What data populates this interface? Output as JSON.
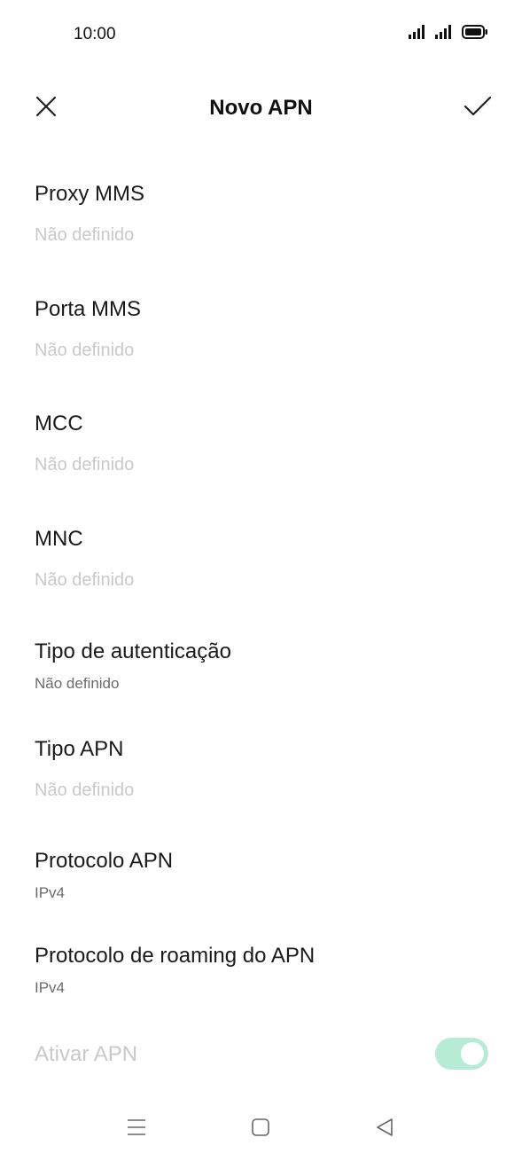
{
  "status_bar": {
    "time": "10:00",
    "icons": [
      "signal-icon",
      "signal-icon",
      "battery-icon"
    ]
  },
  "header": {
    "title": "Novo APN",
    "close_icon": "close-icon",
    "confirm_icon": "check-icon"
  },
  "fields": [
    {
      "label": "Proxy MMS",
      "value": "Não definido",
      "state": "placeholder"
    },
    {
      "label": "Porta MMS",
      "value": "Não definido",
      "state": "placeholder"
    },
    {
      "label": "MCC",
      "value": "Não definido",
      "state": "placeholder"
    },
    {
      "label": "MNC",
      "value": "Não definido",
      "state": "placeholder"
    },
    {
      "label": "Tipo de autenticação",
      "value": "Não definido",
      "state": "set"
    },
    {
      "label": "Tipo APN",
      "value": "Não definido",
      "state": "placeholder"
    },
    {
      "label": "Protocolo APN",
      "value": "IPv4",
      "state": "set"
    },
    {
      "label": "Protocolo de roaming do APN",
      "value": "IPv4",
      "state": "set"
    }
  ],
  "toggle": {
    "label": "Ativar APN",
    "on": true,
    "disabled": true,
    "accent_color": "#b7ecd4"
  },
  "nav_bar": {
    "icons": [
      "menu-icon",
      "home-icon",
      "back-icon"
    ]
  },
  "colors": {
    "placeholder_text": "#c9c9c9",
    "set_value_text": "#6b6b6b",
    "primary_text": "#1a1a1a"
  }
}
